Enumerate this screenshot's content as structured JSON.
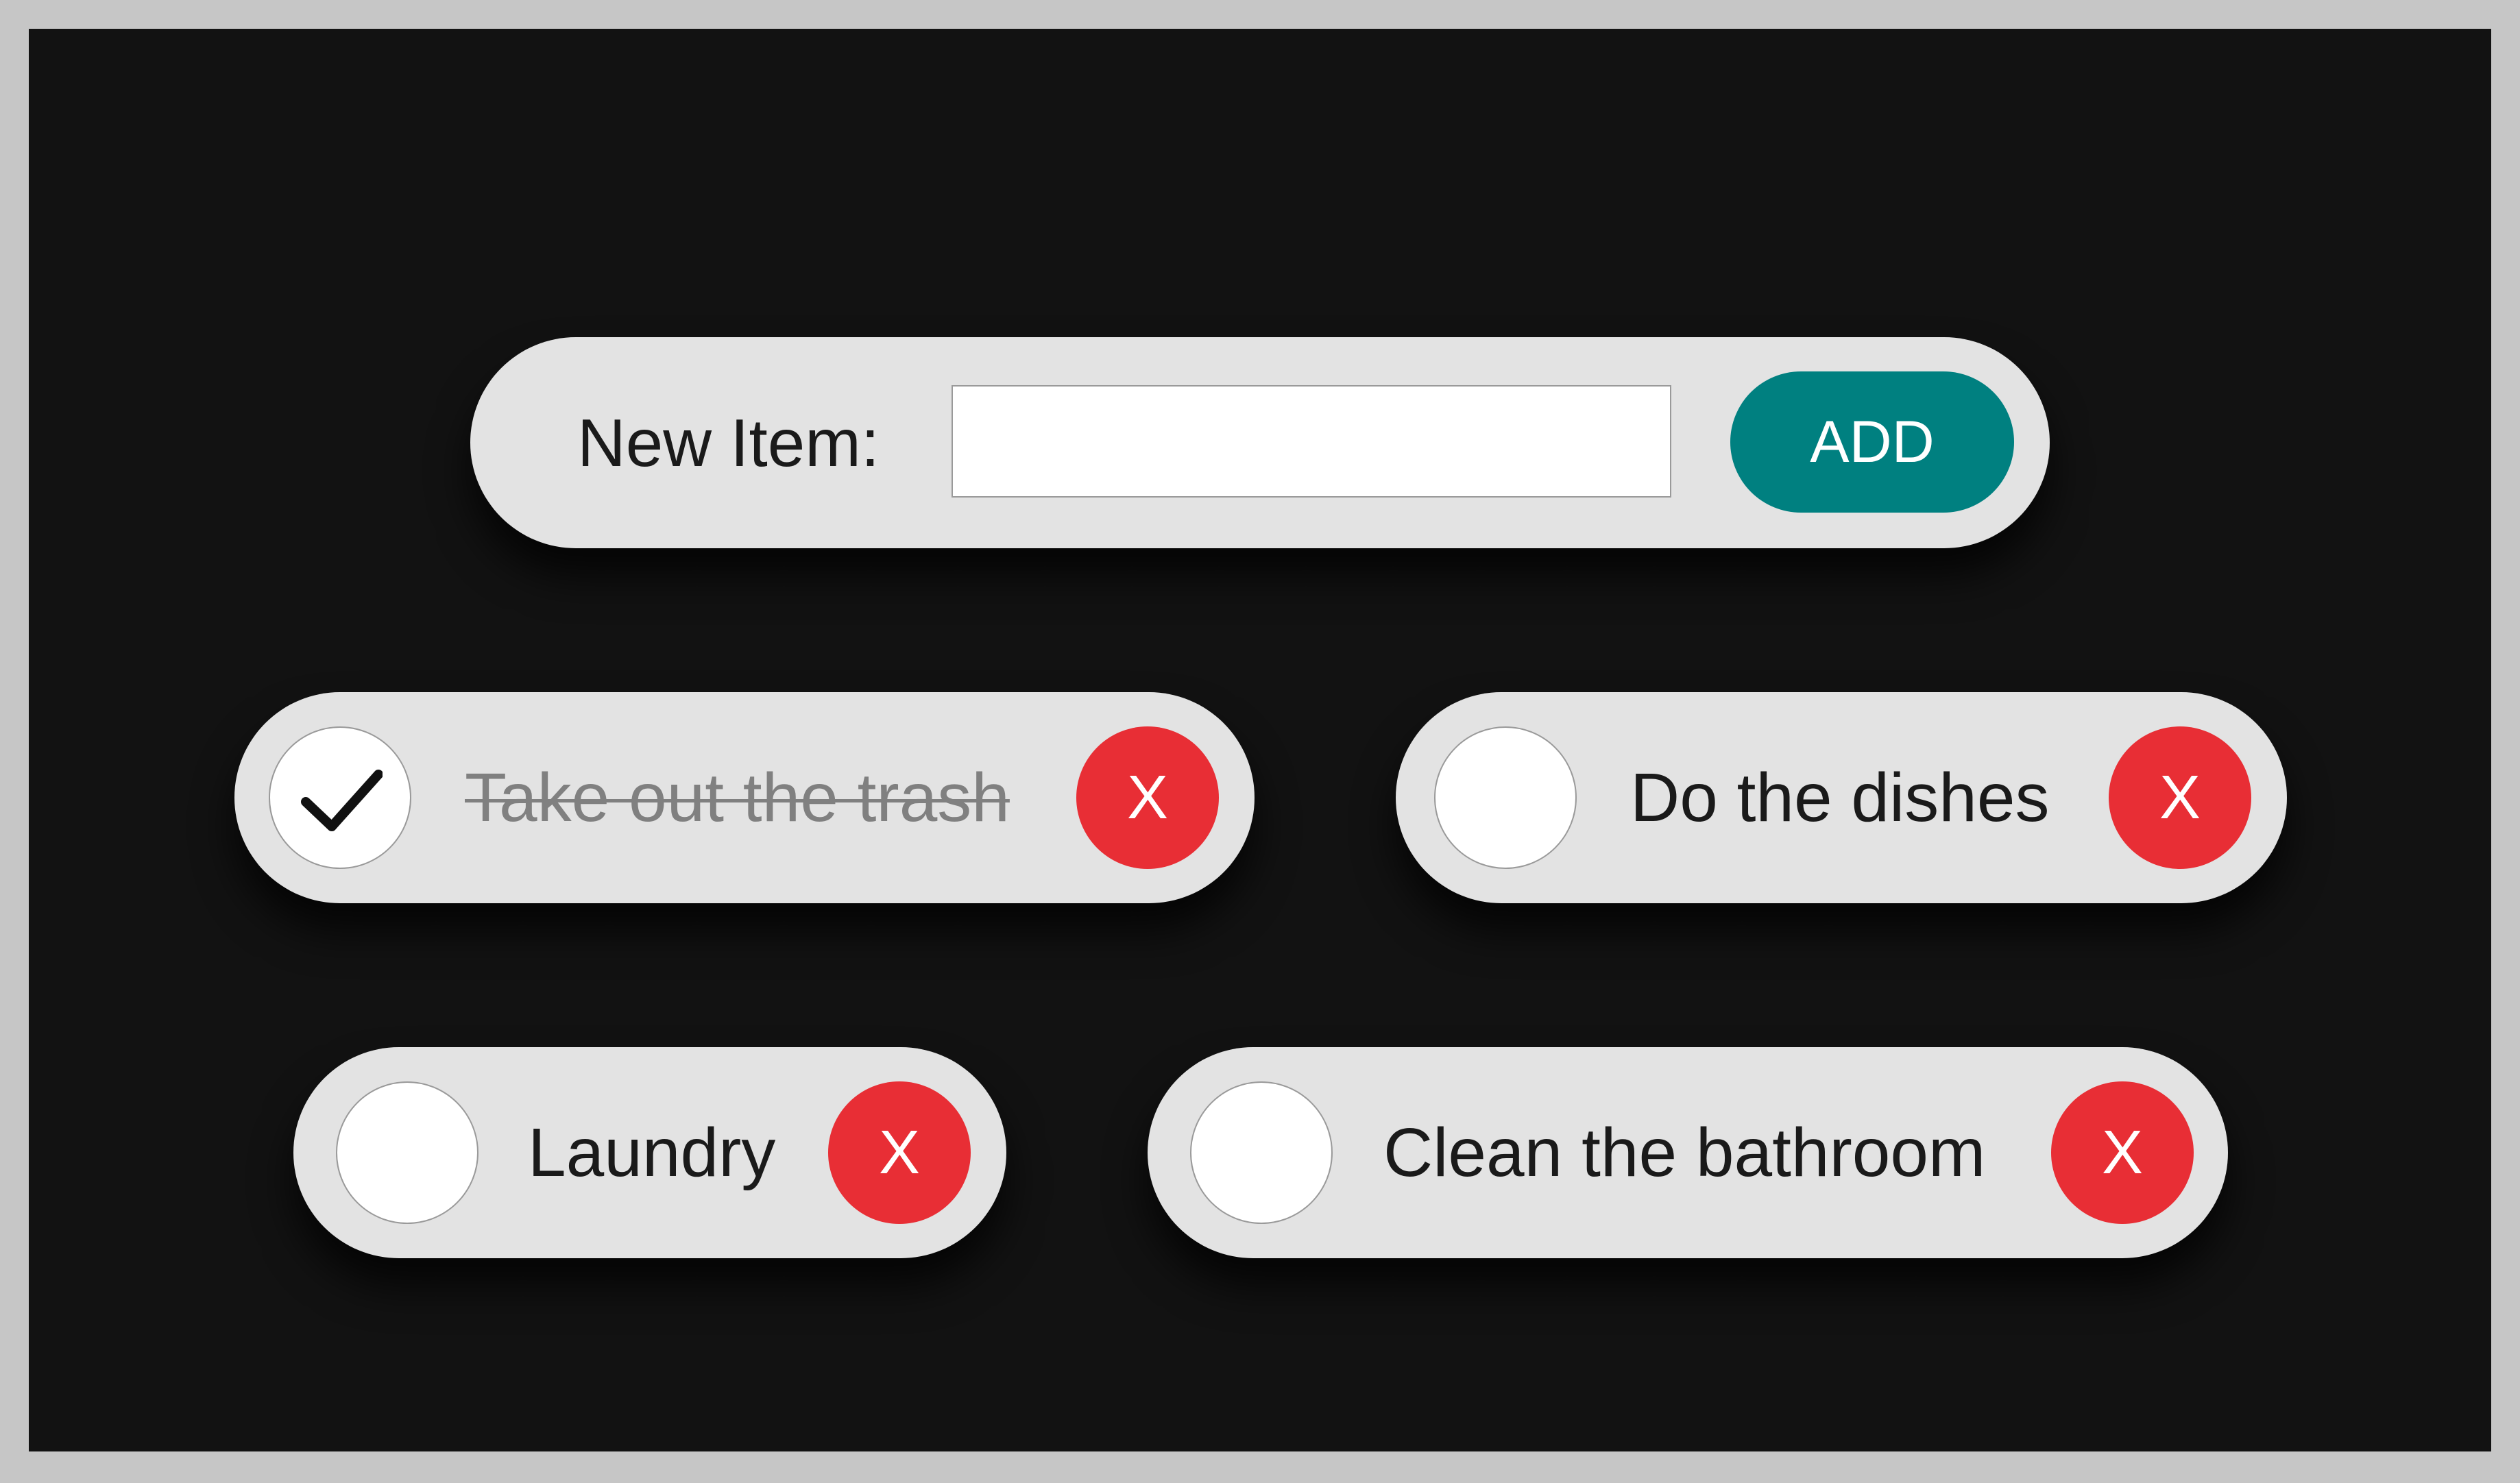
{
  "form": {
    "label": "New Item:",
    "input_value": "",
    "add_label": "ADD"
  },
  "items": [
    {
      "label": "Take out the trash",
      "done": true,
      "delete_label": "X"
    },
    {
      "label": "Do the dishes",
      "done": false,
      "delete_label": "X"
    },
    {
      "label": "Laundry",
      "done": false,
      "delete_label": "X"
    },
    {
      "label": "Clean the bathroom",
      "done": false,
      "delete_label": "X"
    }
  ],
  "icons": {
    "check": "check-icon",
    "delete": "close-icon"
  },
  "colors": {
    "background": "#121212",
    "frame": "#c6c6c6",
    "pill": "#e3e3e3",
    "accent": "#008080",
    "delete": "#e82e35",
    "done_text": "#808080"
  }
}
